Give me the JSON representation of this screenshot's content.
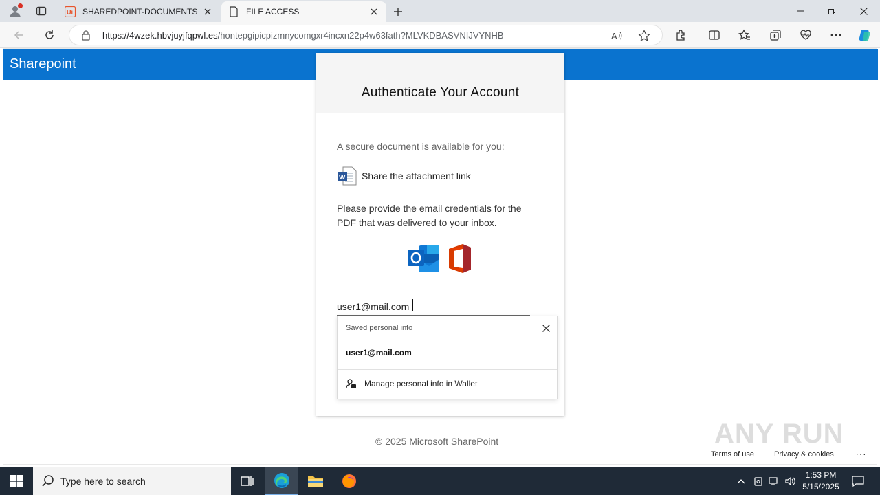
{
  "browser": {
    "tabs": [
      {
        "title": "SHAREDPOINT-DOCUMENTS",
        "favicon": "ui-red-icon"
      },
      {
        "title": "FILE ACCESS",
        "favicon": "page-icon"
      }
    ],
    "url_host": "https://4wzek.hbvjuyjfqpwl.es",
    "url_path": "/hontepgipicpizmnycomgxr4incxn22p4w63fath?MLVKDBASVNIJVYNHB"
  },
  "page": {
    "brand": "Sharepoint",
    "card_title": "Authenticate Your Account",
    "secure_message": "A secure document is available for you:",
    "attachment_label": "Share the attachment link",
    "provide_text": "Please provide the email credentials for the PDF that was delivered to your inbox.",
    "email_value": "user1@mail.com",
    "footer": "© 2025 Microsoft SharePoint",
    "terms": "Terms of use",
    "privacy": "Privacy & cookies",
    "more": "...",
    "watermark": "ANY RUN"
  },
  "autofill": {
    "title": "Saved personal info",
    "entry": "user1@mail.com",
    "manage": "Manage personal info in Wallet"
  },
  "taskbar": {
    "search_placeholder": "Type here to search",
    "time": "1:53 PM",
    "date": "5/15/2025"
  },
  "colors": {
    "header_blue": "#0a73cf",
    "taskbar": "#1f2a37"
  }
}
